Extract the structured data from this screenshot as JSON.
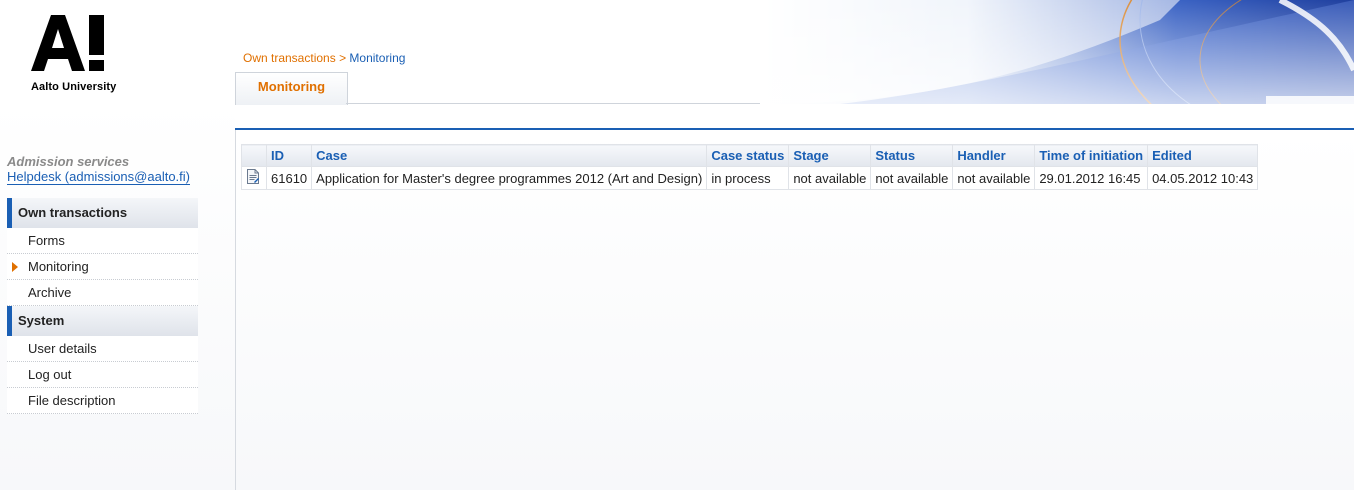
{
  "brand": {
    "logo_text": "Aalto University"
  },
  "sidebar": {
    "service_title": "Admission services",
    "helpdesk": "Helpdesk (admissions@aalto.fi)",
    "groups": [
      {
        "label": "Own transactions",
        "items": [
          {
            "label": "Forms"
          },
          {
            "label": "Monitoring",
            "active": true
          },
          {
            "label": "Archive"
          }
        ]
      },
      {
        "label": "System",
        "items": [
          {
            "label": "User details"
          },
          {
            "label": "Log out"
          },
          {
            "label": "File description"
          }
        ]
      }
    ]
  },
  "breadcrumb": {
    "parent": "Own transactions",
    "separator": ">",
    "current": "Monitoring"
  },
  "tab": {
    "label": "Monitoring"
  },
  "table": {
    "headers": [
      "ID",
      "Case",
      "Case status",
      "Stage",
      "Status",
      "Handler",
      "Time of initiation",
      "Edited"
    ],
    "rows": [
      {
        "icon": "document-icon",
        "cells": [
          "61610",
          "Application for Master's degree programmes 2012 (Art and Design)",
          "in process",
          "not available",
          "not available",
          "not available",
          "29.01.2012 16:45",
          "04.05.2012 10:43"
        ]
      }
    ]
  },
  "colors": {
    "accent_blue": "#1a5fb4",
    "accent_orange": "#e07000"
  }
}
